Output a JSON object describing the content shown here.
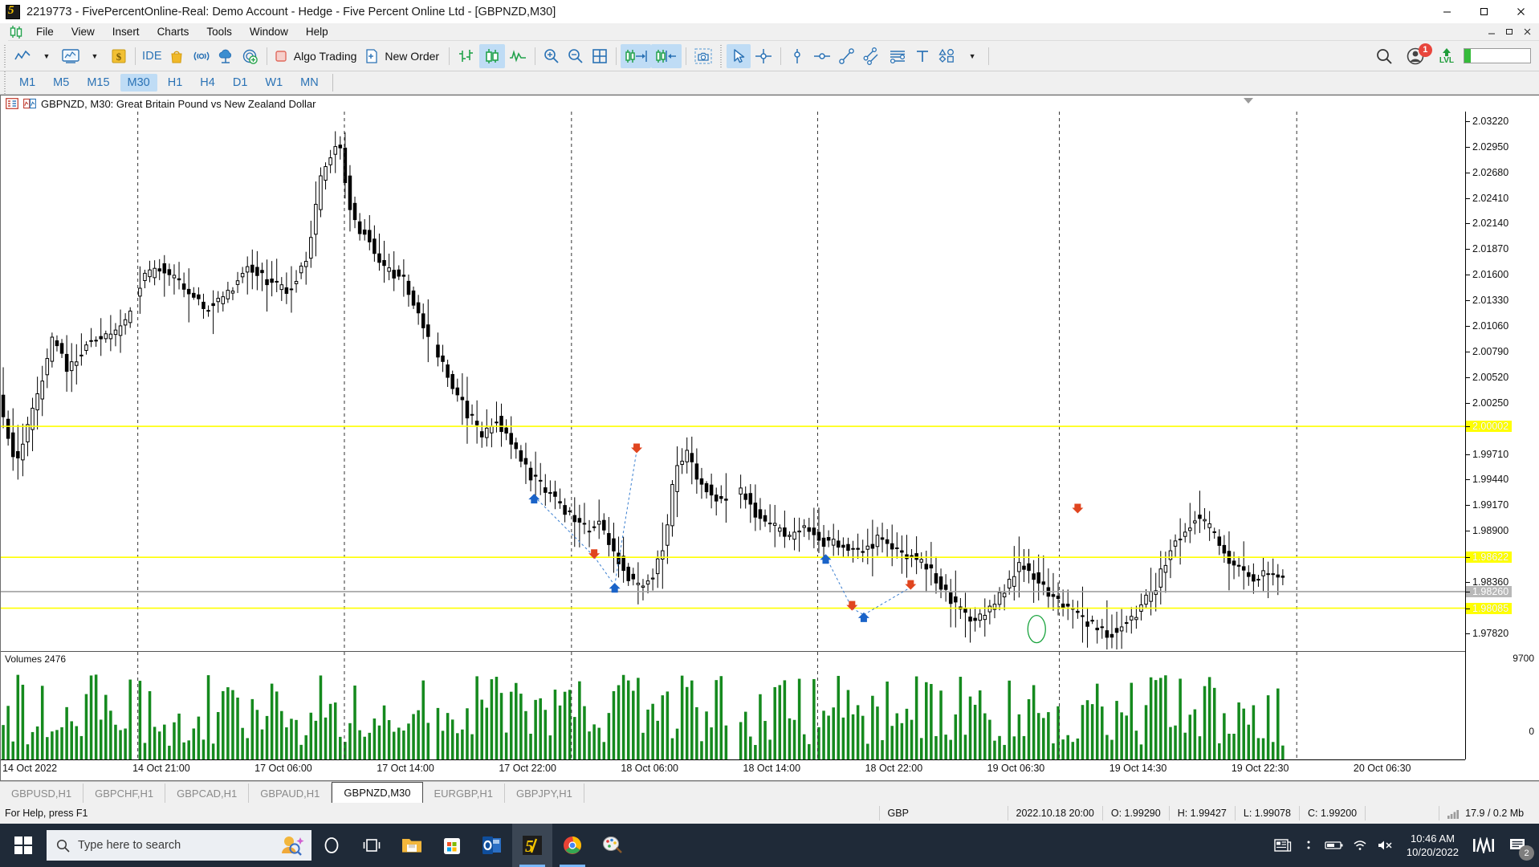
{
  "window": {
    "title": "2219773 - FivePercentOnline-Real: Demo Account - Hedge - Five Percent Online Ltd - [GBPNZD,M30]",
    "app_icon": "mt5-logo-icon",
    "minimize": "–",
    "maximize": "❐",
    "close": "✕"
  },
  "menu": {
    "items": [
      {
        "label": "File"
      },
      {
        "label": "View"
      },
      {
        "label": "Insert"
      },
      {
        "label": "Charts"
      },
      {
        "label": "Tools"
      },
      {
        "label": "Window"
      },
      {
        "label": "Help"
      }
    ],
    "right_buttons": [
      "minimize-icon",
      "restore-icon",
      "close-icon"
    ]
  },
  "toolbar": {
    "chart_type_label": "line-chart-icon",
    "indicators_label": "indicators-icon",
    "dollar_label": "currency-icon",
    "ide_label": "IDE",
    "market_label": "market-bag-icon",
    "signals_label": "signals-icon",
    "vps_label": "vps-cloud-icon",
    "subscribe_label": "subscribe-icon",
    "algo_trading": "Algo Trading",
    "new_order": "New Order",
    "bar_chart": "bar-chart-icon",
    "candle_chart": "candlestick-chart-icon",
    "line_chart": "line-chart-icon2",
    "zoom_in": "zoom-in-icon",
    "zoom_out": "zoom-out-icon",
    "grid": "grid-icon",
    "auto_scroll": "auto-scroll-icon",
    "chart_shift": "chart-shift-icon",
    "screenshot": "screenshot-icon",
    "cursor": "cursor-icon",
    "crosshair": "crosshair-icon",
    "vertical_line": "vertical-line-icon",
    "horizontal_line": "horizontal-line-icon",
    "trendline": "trendline-icon",
    "channel": "equidistant-channel-icon",
    "fibonacci": "fibonacci-icon",
    "text": "text-tool-icon",
    "shapes": "shapes-icon",
    "search": "search-icon",
    "account_notifications": "1",
    "level_label": "LVL",
    "meter_value": ""
  },
  "timeframes": {
    "items": [
      "M1",
      "M5",
      "M15",
      "M30",
      "H1",
      "H4",
      "D1",
      "W1",
      "MN"
    ],
    "active": "M30"
  },
  "chart": {
    "symbol": "GBPNZD",
    "period": "M30",
    "title": "GBPNZD, M30:  Great Britain Pound vs New Zealand Dollar",
    "properties_icon": "chart-properties-icon",
    "indicator_icon": "chart-indicator-icon",
    "collapse_icon": "chevron-down-icon",
    "volume_label": "Volumes 2476",
    "volume_max": "9700",
    "volume_min": "0"
  },
  "chart_data": {
    "type": "line",
    "title": "GBPNZD, M30: Great Britain Pound vs New Zealand Dollar",
    "xlabel": "",
    "ylabel": "Price",
    "grid": true,
    "price_ticks": [
      "2.03220",
      "2.02950",
      "2.02680",
      "2.02410",
      "2.02140",
      "2.01870",
      "2.01600",
      "2.01330",
      "2.01060",
      "2.00790",
      "2.00520",
      "2.00250",
      "1.99710",
      "1.99440",
      "1.99170",
      "1.98900",
      "1.98360",
      "1.97820"
    ],
    "highlighted_price_labels": [
      {
        "value": "2.00002",
        "style": "yellow"
      },
      {
        "value": "1.98622",
        "style": "yellow"
      },
      {
        "value": "1.98260",
        "style": "gray"
      },
      {
        "value": "1.98085",
        "style": "yellow"
      }
    ],
    "time_ticks": [
      "14 Oct 2022",
      "14 Oct 21:00",
      "17 Oct 06:00",
      "17 Oct 14:00",
      "17 Oct 22:00",
      "18 Oct 06:00",
      "18 Oct 14:00",
      "18 Oct 22:00",
      "19 Oct 06:30",
      "19 Oct 14:30",
      "19 Oct 22:30",
      "20 Oct 06:30"
    ],
    "ylim": [
      1.9765,
      2.0332
    ],
    "volume_ylim": [
      0,
      9700
    ],
    "horizontal_lines": [
      {
        "price": "2.00002",
        "color": "#ffff00"
      },
      {
        "price": "1.98622",
        "color": "#ffff00"
      },
      {
        "price": "1.98260",
        "color": "#a0a0a0"
      },
      {
        "price": "1.98085",
        "color": "#ffff00"
      }
    ],
    "trade_markers": [
      {
        "type": "buy",
        "x_pct": 36.4,
        "price": 1.99265
      },
      {
        "type": "sell",
        "x_pct": 40.5,
        "price": 1.9863
      },
      {
        "type": "buy",
        "x_pct": 41.9,
        "price": 1.98325
      },
      {
        "type": "sell",
        "x_pct": 43.4,
        "price": 1.99745
      },
      {
        "type": "buy",
        "x_pct": 56.3,
        "price": 1.9863
      },
      {
        "type": "sell",
        "x_pct": 58.1,
        "price": 1.98085
      },
      {
        "type": "buy",
        "x_pct": 58.9,
        "price": 1.98015
      },
      {
        "type": "sell",
        "x_pct": 62.1,
        "price": 1.98305
      },
      {
        "type": "sell",
        "x_pct": 73.5,
        "price": 1.9911
      }
    ]
  },
  "chart_tabs": {
    "items": [
      {
        "label": "GBPUSD,H1",
        "active": false
      },
      {
        "label": "GBPCHF,H1",
        "active": false
      },
      {
        "label": "GBPCAD,H1",
        "active": false
      },
      {
        "label": "GBPAUD,H1",
        "active": false
      },
      {
        "label": "GBPNZD,M30",
        "active": true
      },
      {
        "label": "EURGBP,H1",
        "active": false
      },
      {
        "label": "GBPJPY,H1",
        "active": false
      }
    ]
  },
  "statusbar": {
    "help": "For Help, press F1",
    "currency": "GBP",
    "datetime": "2022.10.18 20:00",
    "open": "O: 1.99290",
    "high": "H: 1.99427",
    "low": "L: 1.99078",
    "close": "C: 1.99200",
    "traffic": "17.9 / 0.2 Mb"
  },
  "taskbar": {
    "start": "windows-start-icon",
    "search_placeholder": "Type here to search",
    "search_icon": "search-icon",
    "cortana": "cortana-icon",
    "taskview": "task-view-icon",
    "apps": [
      {
        "name": "file-explorer-icon"
      },
      {
        "name": "microsoft-store-icon"
      },
      {
        "name": "outlook-icon"
      },
      {
        "name": "metatrader5-icon"
      },
      {
        "name": "google-chrome-icon"
      },
      {
        "name": "paint-icon"
      }
    ],
    "tray": [
      {
        "name": "news-icon"
      },
      {
        "name": "overflow-icon"
      },
      {
        "name": "battery-icon"
      },
      {
        "name": "wifi-icon"
      },
      {
        "name": "volume-muted-icon"
      }
    ],
    "time": "10:46 AM",
    "date": "10/20/2022",
    "mt-tray-icon": "metaquotes-tray-icon",
    "notifications_icon": "action-center-icon",
    "notifications_count": "2"
  }
}
